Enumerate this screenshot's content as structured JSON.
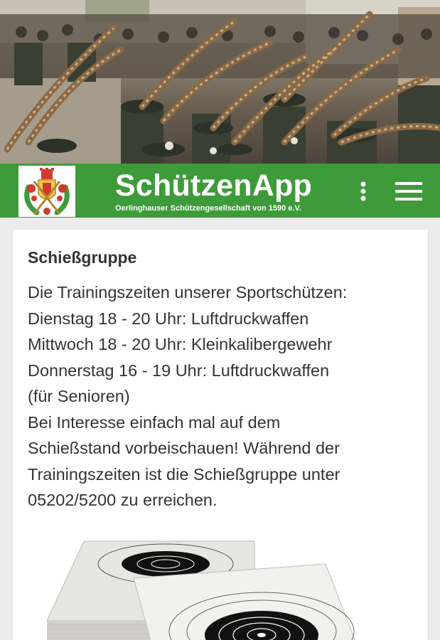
{
  "app_bar": {
    "title": "SchützenApp",
    "subtitle": "Oerlinghauser Schützengesellschaft von 1590 e.V.",
    "background_color": "#3e9b3a",
    "more_icon": "more-vertical-icon",
    "menu_icon": "hamburger-menu-icon"
  },
  "content": {
    "heading": "Schießgruppe",
    "lines": [
      "Die Trainingszeiten unserer Sportschützen:",
      "Dienstag 18 - 20 Uhr: Luftdruckwaffen",
      "Mittwoch 18 - 20 Uhr: Kleinkalibergewehr",
      "Donnerstag 16 - 19 Uhr: Luftdruckwaffen",
      "(für Senioren)",
      "Bei Interesse einfach mal auf dem",
      "Schießstand vorbeischauen! Während der",
      "Trainingszeiten ist die Schießgruppe unter",
      "05202/5200 zu erreichen."
    ]
  }
}
